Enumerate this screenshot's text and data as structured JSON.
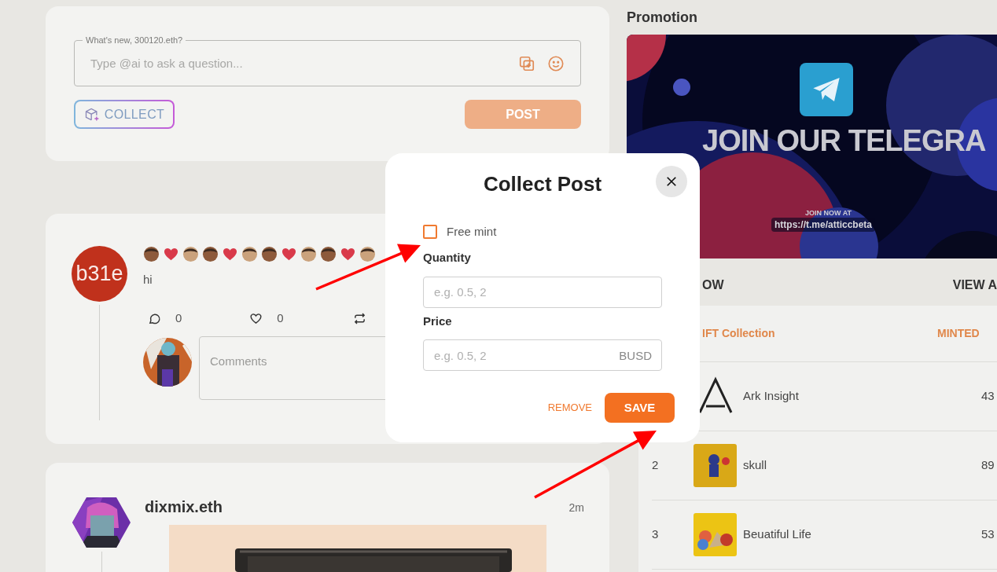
{
  "composer": {
    "legend": "What's new, 300120.eth?",
    "placeholder": "Type @ai to ask a question...",
    "collect_button": "COLLECT",
    "post_button": "POST",
    "post_disabled": true
  },
  "posts": [
    {
      "kind": "text",
      "avatar_text": "b31e",
      "emoji": [
        {
          "kind": "face",
          "color": "#8d5a3b"
        },
        {
          "kind": "heart",
          "color": "#d93a4a"
        },
        {
          "kind": "face",
          "color": "#caa27c"
        },
        {
          "kind": "face",
          "color": "#8d5a3b"
        },
        {
          "kind": "heart",
          "color": "#d93a4a"
        },
        {
          "kind": "face",
          "color": "#caa27c"
        },
        {
          "kind": "face",
          "color": "#8d5a3b"
        },
        {
          "kind": "heart",
          "color": "#d93a4a"
        },
        {
          "kind": "face",
          "color": "#caa27c"
        },
        {
          "kind": "face",
          "color": "#8d5a3b"
        },
        {
          "kind": "heart",
          "color": "#d93a4a"
        },
        {
          "kind": "face",
          "color": "#caa27c"
        }
      ],
      "body": "hi",
      "comments": "0",
      "likes": "0",
      "comment_placeholder": "Comments"
    },
    {
      "author": "dixmix.eth",
      "time": "2m"
    }
  ],
  "promotion": {
    "title": "Promotion",
    "headline": "JOIN OUR TELEGRA",
    "subline": "JOIN NOW AT",
    "link": "https://t.me/atticcbeta"
  },
  "ranking": {
    "title": "OW",
    "view_all": "VIEW A",
    "columns": [
      "IFT Collection",
      "MINTED"
    ],
    "rows": [
      {
        "rank": "",
        "name": "Ark Insight",
        "minted": "43",
        "kind": "logo"
      },
      {
        "rank": "2",
        "name": "skull",
        "minted": "89",
        "kind": "picture"
      },
      {
        "rank": "3",
        "name": "Beuatiful Life",
        "minted": "53",
        "kind": "picture"
      }
    ]
  },
  "modal": {
    "title": "Collect Post",
    "free_mint": {
      "label": "Free mint",
      "checked": false
    },
    "fields": [
      {
        "label": "Quantity",
        "placeholder": "e.g. 0.5, 2"
      },
      {
        "label": "Price",
        "placeholder": "e.g. 0.5, 2",
        "suffix": "BUSD"
      }
    ],
    "remove_button": "REMOVE",
    "save_button": "SAVE"
  }
}
